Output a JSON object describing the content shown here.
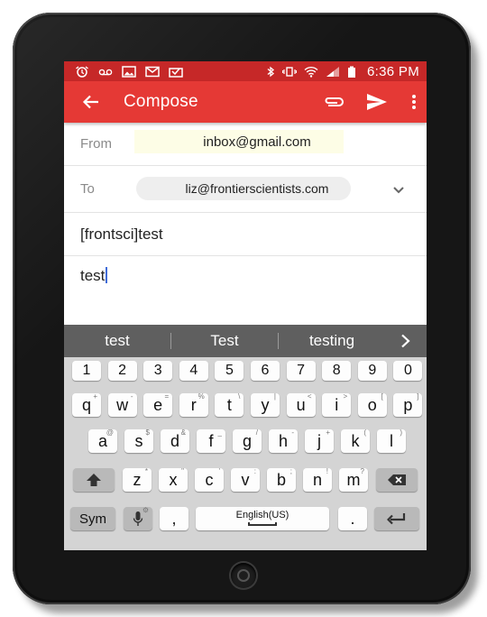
{
  "status_bar": {
    "time": "6:36 PM",
    "left_icons": [
      "alarm-icon",
      "voicemail-icon",
      "image-icon",
      "gmail-icon",
      "inbox-icon"
    ],
    "right_icons": [
      "bluetooth-icon",
      "vibrate-icon",
      "wifi-icon",
      "signal-icon",
      "battery-icon"
    ]
  },
  "toolbar": {
    "title": "Compose",
    "background": "#e53935",
    "statusbar_background": "#c62828"
  },
  "compose": {
    "from_label": "From",
    "from_value": "inbox@gmail.com",
    "to_label": "To",
    "to_value": "liz@frontierscientists.com",
    "subject": "[frontsci]test",
    "body": "test"
  },
  "keyboard": {
    "suggestions": [
      "test",
      "Test",
      "testing"
    ],
    "number_row": [
      "1",
      "2",
      "3",
      "4",
      "5",
      "6",
      "7",
      "8",
      "9",
      "0"
    ],
    "row1": [
      {
        "k": "q",
        "h": "+"
      },
      {
        "k": "w",
        "h": "-"
      },
      {
        "k": "e",
        "h": "="
      },
      {
        "k": "r",
        "h": "%"
      },
      {
        "k": "t",
        "h": "\\"
      },
      {
        "k": "y",
        "h": "|"
      },
      {
        "k": "u",
        "h": "<"
      },
      {
        "k": "i",
        "h": ">"
      },
      {
        "k": "o",
        "h": "["
      },
      {
        "k": "p",
        "h": "]"
      }
    ],
    "row2": [
      {
        "k": "a",
        "h": "@"
      },
      {
        "k": "s",
        "h": "$"
      },
      {
        "k": "d",
        "h": "&"
      },
      {
        "k": "f",
        "h": "_"
      },
      {
        "k": "g",
        "h": "/"
      },
      {
        "k": "h",
        "h": "-"
      },
      {
        "k": "j",
        "h": "+"
      },
      {
        "k": "k",
        "h": "("
      },
      {
        "k": "l",
        "h": ")"
      }
    ],
    "row3": [
      {
        "k": "z",
        "h": "*"
      },
      {
        "k": "x",
        "h": "\""
      },
      {
        "k": "c",
        "h": "'"
      },
      {
        "k": "v",
        "h": ":"
      },
      {
        "k": "b",
        "h": ";"
      },
      {
        "k": "n",
        "h": "!"
      },
      {
        "k": "m",
        "h": "?"
      }
    ],
    "sym_label": "Sym",
    "comma_label": ",",
    "space_label": "English(US)",
    "period_label": "."
  }
}
